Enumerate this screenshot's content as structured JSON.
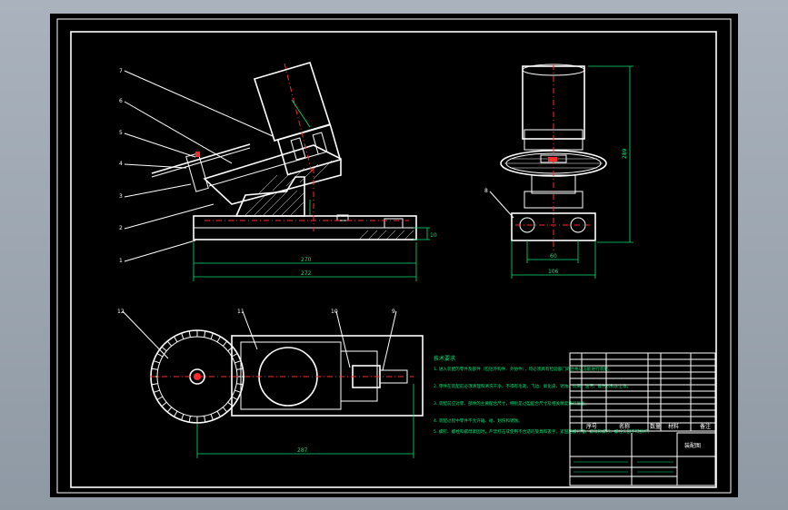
{
  "balloons": [
    "1",
    "2",
    "3",
    "4",
    "5",
    "6",
    "7",
    "8",
    "9",
    "10",
    "11",
    "12"
  ],
  "dimensions": {
    "front_length_inner": "270",
    "front_length_outer": "272",
    "front_base_height": "10",
    "side_height": "289",
    "side_width_inner": "60",
    "side_width_outer": "106",
    "top_length": "287"
  },
  "tech_notes": {
    "heading": "技术要求",
    "lines": [
      "1. 进入装配的零件及部件（包括外购件、外协件），均必须具有检验部门的合格证方能进行装配。",
      "2. 零件在装配前必须清理和清洗干净，不得有毛刺、飞边、氧化皮、锈蚀、切屑、油污、着色剂和灰尘等。",
      "3. 装配前应对零、部件的主要配合尺寸，特别是过盈配合尺寸及相关精度进行复查。",
      "4. 装配过程中零件不允许磕、碰、划伤和锈蚀。",
      "5. 螺钉、螺栓和螺母紧固时，严禁打击或使用不合适的旋具和扳手。紧固后螺钉槽、螺母和螺钉、螺栓头部不得损坏。"
    ]
  },
  "title_block": {
    "col_seq": "序号",
    "col_name": "名称",
    "col_qty": "数量",
    "col_material": "材料",
    "col_note": "备注",
    "drawing_title": "装配图"
  },
  "colors": {
    "sheet": "#000000",
    "outline": "#ffffff",
    "centerline": "#ff2a2a",
    "dimension": "#00e676"
  }
}
